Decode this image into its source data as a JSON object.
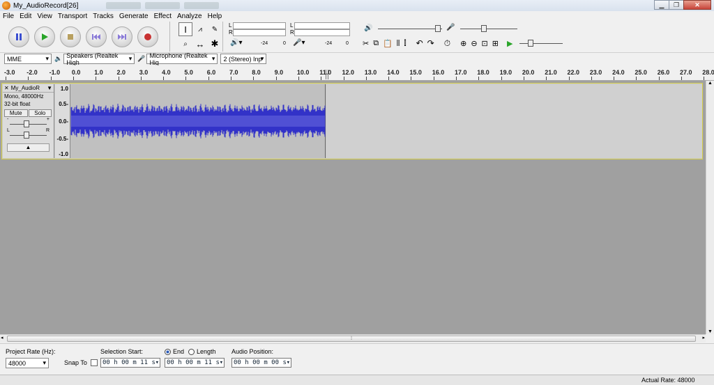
{
  "window": {
    "title": "My_AudioRecord[26]"
  },
  "menu": [
    "File",
    "Edit",
    "View",
    "Transport",
    "Tracks",
    "Generate",
    "Effect",
    "Analyze",
    "Help"
  ],
  "meters": {
    "playback_channels": [
      "L",
      "R"
    ],
    "record_channels": [
      "L",
      "R"
    ],
    "db_labels": [
      "-24",
      "0",
      "-24",
      "0"
    ]
  },
  "device": {
    "host": "MME",
    "playback": "Speakers (Realtek High",
    "recording": "Microphone (Realtek Hig",
    "channels": "2 (Stereo) Inp"
  },
  "ruler": {
    "ticks": [
      "-3.0",
      "-2.0",
      "-1.0",
      "0.0",
      "1.0",
      "2.0",
      "3.0",
      "4.0",
      "5.0",
      "6.0",
      "7.0",
      "8.0",
      "9.0",
      "10.0",
      "11.0",
      "12.0",
      "13.0",
      "14.0",
      "15.0",
      "16.0",
      "17.0",
      "18.0",
      "19.0",
      "20.0",
      "21.0",
      "22.0",
      "23.0",
      "24.0",
      "25.0",
      "26.0",
      "27.0",
      "28.0"
    ]
  },
  "track": {
    "name": "My_AudioR",
    "format_line1": "Mono, 48000Hz",
    "format_line2": "32-bit float",
    "mute_label": "Mute",
    "solo_label": "Solo",
    "gain_minus": "-",
    "gain_plus": "+",
    "pan_left": "L",
    "pan_right": "R",
    "scale": [
      "1.0",
      "0.5-",
      "0.0-",
      "-0.5-",
      "-1.0"
    ],
    "waveform_color": "#3232c8",
    "selection_color": "#d6d04a"
  },
  "selection_toolbar": {
    "project_rate_label": "Project Rate (Hz):",
    "project_rate": "48000",
    "snap_label": "Snap To",
    "selection_start_label": "Selection Start:",
    "end_label": "End",
    "length_label": "Length",
    "audio_position_label": "Audio Position:",
    "selection_start": "00 h 00 m 11 s",
    "selection_end": "00 h 00 m 11 s",
    "audio_position": "00 h 00 m 00 s"
  },
  "status": {
    "actual_rate": "Actual Rate: 48000"
  }
}
